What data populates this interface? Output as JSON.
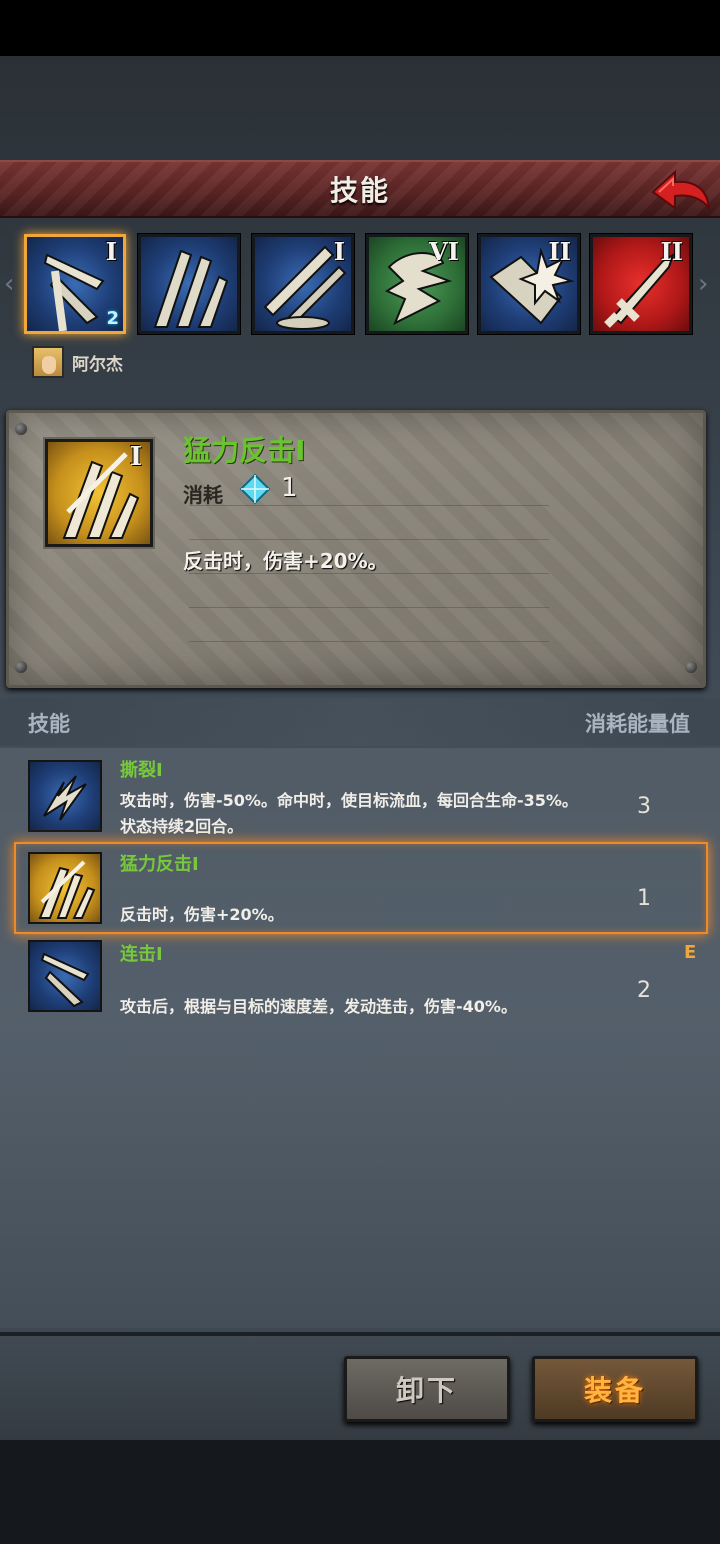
{
  "header": {
    "title": "技能",
    "back_icon": "back-arrow-icon"
  },
  "skill_slots": [
    {
      "icon": "dual-blade-icon",
      "roman": "I",
      "level": "2",
      "color": "#2a5096",
      "selected": true
    },
    {
      "icon": "claw-strike-icon",
      "roman": "",
      "color": "#2a5096"
    },
    {
      "icon": "crossed-swords-icon",
      "roman": "I",
      "color": "#2a5096"
    },
    {
      "icon": "wind-slash-icon",
      "roman": "VI",
      "color": "#3a8a46"
    },
    {
      "icon": "shield-burst-icon",
      "roman": "II",
      "color": "#2a5096"
    },
    {
      "icon": "sword-icon",
      "roman": "II",
      "color": "#c41a1a"
    }
  ],
  "hero": {
    "name": "阿尔杰",
    "avatar_icon": "hero-portrait-icon"
  },
  "detail": {
    "title": "猛力反击I",
    "roman": "I",
    "cost_label": "消耗",
    "cost_icon": "energy-crystal-icon",
    "cost_value": "1",
    "description": "反击时，伤害+20%。"
  },
  "list_header": {
    "left": "技能",
    "right": "消耗能量值"
  },
  "skills": [
    {
      "name": "撕裂I",
      "description": "攻击时，伤害-50%。命中时，使目标流血，每回合生命-35%。状态持续2回合。",
      "cost": "3",
      "icon": "bleed-claw-icon",
      "selected": false
    },
    {
      "name": "猛力反击I",
      "description": "反击时，伤害+20%。",
      "cost": "1",
      "icon": "counter-strike-icon",
      "selected": true
    },
    {
      "name": "连击I",
      "description": "攻击后，根据与目标的速度差，发动连击，伤害-40%。",
      "cost": "2",
      "icon": "combo-blade-icon",
      "selected": false
    }
  ],
  "equipped_mark": "E",
  "buttons": {
    "unequip": "卸下",
    "equip": "装备"
  },
  "colors": {
    "accent": "#f0a638",
    "skill_name": "#78c83c",
    "header": "#6a2c2c"
  }
}
